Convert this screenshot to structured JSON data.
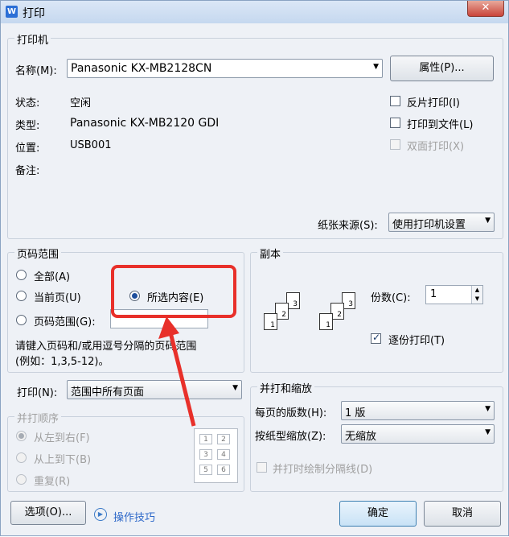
{
  "window": {
    "title": "打印",
    "app_icon": "W",
    "close": "✕"
  },
  "printer": {
    "group_title": "打印机",
    "name_label": "名称(M):",
    "name_value": "Panasonic KX-MB2128CN",
    "properties_button": "属性(P)...",
    "status_label": "状态:",
    "status_value": "空闲",
    "type_label": "类型:",
    "type_value": "Panasonic KX-MB2120 GDI",
    "location_label": "位置:",
    "location_value": "USB001",
    "comment_label": "备注:",
    "reverse_print": "反片打印(I)",
    "print_to_file": "打印到文件(L)",
    "duplex": "双面打印(X)",
    "paper_source_label": "纸张来源(S):",
    "paper_source_value": "使用打印机设置"
  },
  "page_range": {
    "group_title": "页码范围",
    "all": "全部(A)",
    "current": "当前页(U)",
    "selection": "所选内容(E)",
    "pages": "页码范围(G):",
    "hint_line1": "请键入页码和/或用逗号分隔的页码范围",
    "hint_line2": "(例如：1,3,5-12)。",
    "selected": "selection"
  },
  "print_what": {
    "label": "打印(N):",
    "value": "范围中所有页面",
    "order_title": "并打顺序",
    "order_ltr": "从左到右(F)",
    "order_ttb": "从上到下(B)",
    "order_repeat": "重复(R)",
    "grid": [
      "1",
      "2",
      "3",
      "4",
      "5",
      "6"
    ]
  },
  "copies": {
    "group_title": "副本",
    "count_label": "份数(C):",
    "count_value": "1",
    "collate": "逐份打印(T)",
    "collate_checked": true,
    "stack_a": [
      "1",
      "2",
      "3"
    ],
    "stack_b": [
      "1",
      "2",
      "3"
    ]
  },
  "zoom": {
    "group_title": "并打和缩放",
    "pages_per_sheet_label": "每页的版数(H):",
    "pages_per_sheet_value": "1 版",
    "scale_label": "按纸型缩放(Z):",
    "scale_value": "无缩放",
    "draw_borders": "并打时绘制分隔线(D)"
  },
  "footer": {
    "options_button": "选项(O)...",
    "tips_link": "操作技巧",
    "ok_button": "确定",
    "cancel_button": "取消"
  },
  "annotation": {
    "color": "#e8302a"
  }
}
